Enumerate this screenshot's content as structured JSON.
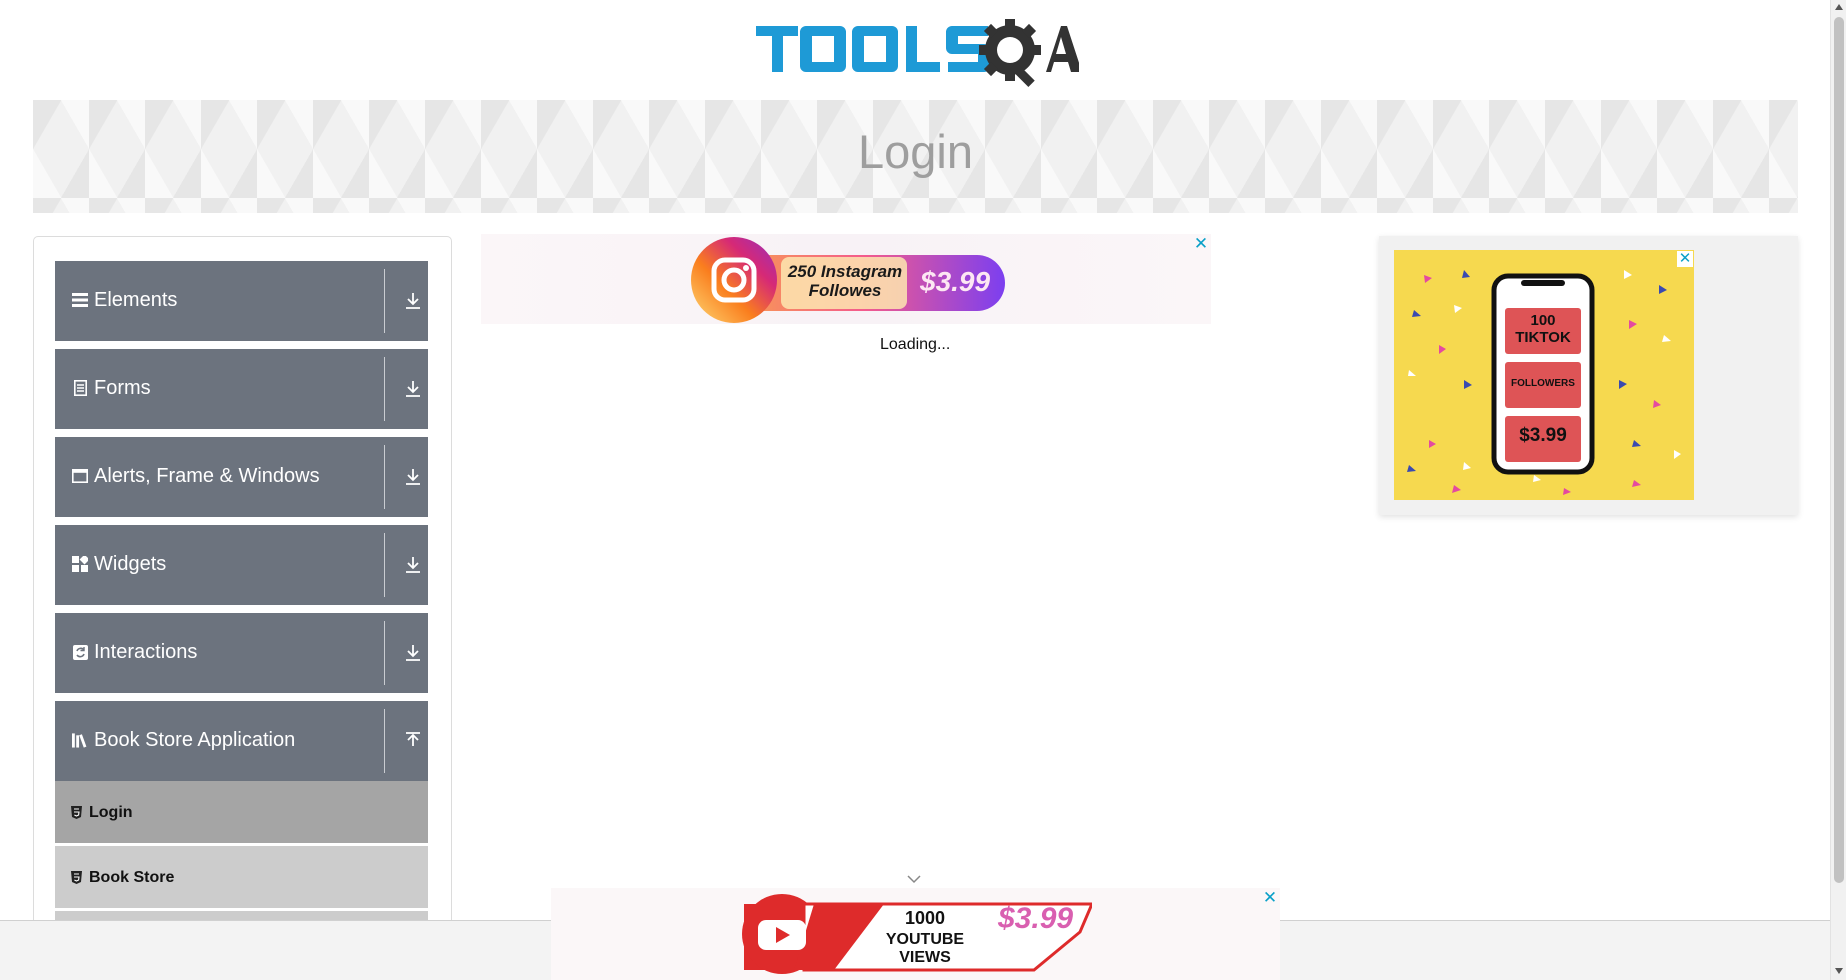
{
  "header": {
    "logo_text": "TOOLSQA"
  },
  "banner": {
    "title": "Login"
  },
  "sidebar": {
    "groups": [
      {
        "label": "Elements",
        "icon": "hamburger-icon",
        "expanded": false
      },
      {
        "label": "Forms",
        "icon": "document-icon",
        "expanded": false
      },
      {
        "label": "Alerts, Frame & Windows",
        "icon": "window-icon",
        "expanded": false
      },
      {
        "label": "Widgets",
        "icon": "widgets-icon",
        "expanded": false
      },
      {
        "label": "Interactions",
        "icon": "interactions-icon",
        "expanded": false
      },
      {
        "label": "Book Store Application",
        "icon": "books-icon",
        "expanded": true
      }
    ],
    "book_store_items": [
      {
        "label": "Login",
        "active": true
      },
      {
        "label": "Book Store",
        "active": false
      }
    ]
  },
  "main": {
    "loading_text": "Loading..."
  },
  "ads": {
    "top_banner": {
      "headline": "250 Instagram Followes",
      "price": "$3.99"
    },
    "right_banner": {
      "line1": "100",
      "line2": "TIKTOK",
      "line3": "FOLLOWERS",
      "price": "$3.99"
    },
    "bottom_banner": {
      "line1": "1000",
      "line2": "YOUTUBE VIEWS",
      "price": "$3.99"
    },
    "close_glyph": "✕"
  },
  "colors": {
    "sidebar_group_bg": "#6c737e",
    "sidebar_active_item_bg": "#a5a5a5",
    "sidebar_item_bg": "#cccccc",
    "banner_title": "#9e9e9e",
    "ad_close": "#0aa0c8",
    "logo_blue": "#1e9ad6"
  }
}
